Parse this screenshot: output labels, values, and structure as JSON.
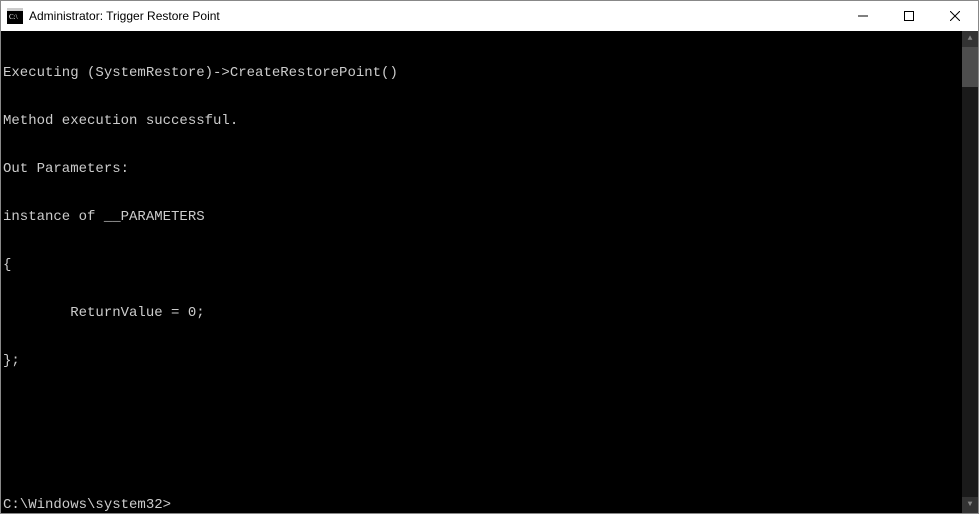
{
  "window": {
    "title": "Administrator: Trigger Restore Point"
  },
  "console": {
    "lines": [
      "Executing (SystemRestore)->CreateRestorePoint()",
      "Method execution successful.",
      "Out Parameters:",
      "instance of __PARAMETERS",
      "{",
      "        ReturnValue = 0;",
      "};",
      "",
      "",
      "C:\\Windows\\system32>"
    ]
  }
}
